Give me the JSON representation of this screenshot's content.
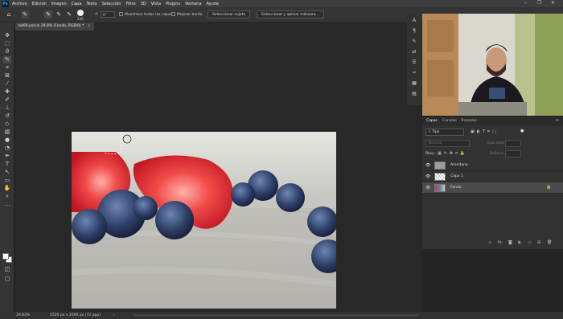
{
  "menubar": {
    "logo": "Ps",
    "items": [
      "Archivo",
      "Edición",
      "Imagen",
      "Capa",
      "Texto",
      "Selección",
      "Filtro",
      "3D",
      "Vista",
      "Plugins",
      "Ventana",
      "Ayuda"
    ],
    "window_controls": [
      "–",
      "❐",
      "✕"
    ]
  },
  "optionsbar": {
    "brush_size": "220",
    "angle": "0°",
    "sample_all_layers": "Muestrear todas las capas",
    "enhance_edge": "Mejorar borde",
    "select_subject": "Seleccionar sujeto",
    "select_and_mask": "Seleccionar y aplicar máscara..."
  },
  "document": {
    "tab_title": "b468.psd al 29,8% (Fondo, RGB/8) *",
    "zoom": "29,83%",
    "dimensions": "2520 px x 2000 px (72 ppp)"
  },
  "tools": [
    "move-icon",
    "marquee-icon",
    "lasso-icon",
    "quick-select-icon",
    "crop-icon",
    "frame-icon",
    "eyedropper-icon",
    "healing-icon",
    "brush-icon",
    "stamp-icon",
    "history-brush-icon",
    "eraser-icon",
    "gradient-icon",
    "blur-icon",
    "dodge-icon",
    "pen-icon",
    "type-icon",
    "path-select-icon",
    "shape-icon",
    "hand-icon",
    "zoom-icon",
    "more-icon"
  ],
  "panel": {
    "tabs": [
      "Capas",
      "Canales",
      "Trazados"
    ],
    "filter_kind": "Tipo",
    "blend_mode": "Normal",
    "opacity_label": "Opacidad:",
    "lock_label": "Bloq.:",
    "fill_label": "Relleno:",
    "layers": [
      {
        "name": "Arandano",
        "selected": false
      },
      {
        "name": "Capa 1",
        "selected": false
      },
      {
        "name": "Fondo",
        "selected": true
      }
    ]
  },
  "colors": {
    "accent": "#31a8ff",
    "panel_bg": "#323232",
    "selected_layer": "#4a4a4a"
  }
}
